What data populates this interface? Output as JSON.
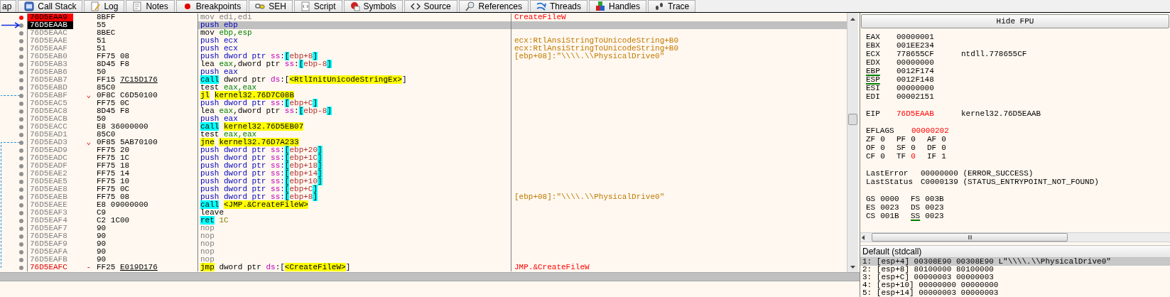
{
  "tabs": [
    "ap",
    "Call Stack",
    "Log",
    "Notes",
    "Breakpoints",
    "SEH",
    "Script",
    "Symbols",
    "Source",
    "References",
    "Threads",
    "Handles",
    "Trace"
  ],
  "disassembly": [
    {
      "address": "76D5EAA9",
      "kind": "breakpoint",
      "breakpoint": true,
      "selected": false,
      "bytes": [
        "8BFF"
      ],
      "reloc": false,
      "tokens": [
        {
          "text": "mov edi,edi",
          "kind": "dim"
        }
      ],
      "comment": {
        "text": "CreateFileW",
        "kind": "label"
      }
    },
    {
      "address": "76D5EAAB",
      "kind": "eip",
      "breakpoint": false,
      "selected": true,
      "bytes": [
        "55"
      ],
      "reloc": false,
      "tokens": [
        {
          "text": "push ebp",
          "kind": "push"
        }
      ]
    },
    {
      "address": "76D5EAAC",
      "kind": "normal",
      "breakpoint": false,
      "selected": false,
      "bytes": [
        "8BEC"
      ],
      "reloc": false,
      "tokens": [
        {
          "text": "mov ",
          "kind": "plain"
        },
        {
          "text": "ebp,esp",
          "kind": "reg"
        }
      ]
    },
    {
      "address": "76D5EAAE",
      "kind": "normal",
      "breakpoint": false,
      "selected": false,
      "bytes": [
        "51"
      ],
      "reloc": false,
      "tokens": [
        {
          "text": "push ecx",
          "kind": "push"
        }
      ],
      "comment": {
        "text": "ecx:RtlAnsiStringToUnicodeString+B0",
        "kind": "auto"
      }
    },
    {
      "address": "76D5EAAF",
      "kind": "normal",
      "breakpoint": false,
      "selected": false,
      "bytes": [
        "51"
      ],
      "reloc": false,
      "tokens": [
        {
          "text": "push ecx",
          "kind": "push"
        }
      ],
      "comment": {
        "text": "ecx:RtlAnsiStringToUnicodeString+B0",
        "kind": "auto"
      }
    },
    {
      "address": "76D5EAB0",
      "kind": "normal",
      "breakpoint": false,
      "selected": false,
      "bytes": [
        "FF75",
        "08"
      ],
      "reloc": false,
      "tokens": [
        {
          "text": "push dword ptr ",
          "kind": "push"
        },
        {
          "text": "ss",
          "kind": "seg"
        },
        {
          "text": ":",
          "kind": "push"
        },
        {
          "text": "[ebp+8]",
          "kind": "mem"
        }
      ],
      "comment": {
        "text": "[ebp+08]:\"\\\\\\\\.\\\\PhysicalDrive0\"",
        "kind": "auto"
      }
    },
    {
      "address": "76D5EAB3",
      "kind": "normal",
      "breakpoint": false,
      "selected": false,
      "bytes": [
        "8D45",
        "F8"
      ],
      "reloc": false,
      "tokens": [
        {
          "text": "lea ",
          "kind": "plain"
        },
        {
          "text": "eax",
          "kind": "reg"
        },
        {
          "text": ",dword ptr ",
          "kind": "plain"
        },
        {
          "text": "ss",
          "kind": "seg"
        },
        {
          "text": ":",
          "kind": "plain"
        },
        {
          "text": "[ebp-8]",
          "kind": "mem"
        }
      ]
    },
    {
      "address": "76D5EAB6",
      "kind": "normal",
      "breakpoint": false,
      "selected": false,
      "bytes": [
        "50"
      ],
      "reloc": false,
      "tokens": [
        {
          "text": "push eax",
          "kind": "push"
        }
      ]
    },
    {
      "address": "76D5EAB7",
      "kind": "normal",
      "breakpoint": false,
      "selected": false,
      "bytes": [
        "FF15",
        "7C15D176"
      ],
      "reloc": true,
      "tokens": [
        {
          "text": "call",
          "kind": "callop"
        },
        {
          "text": " dword ptr ",
          "kind": "plain"
        },
        {
          "text": "ds",
          "kind": "seg"
        },
        {
          "text": ":[",
          "kind": "plain"
        },
        {
          "text": "<RtlInitUnicodeStringEx>",
          "kind": "sym"
        },
        {
          "text": "]",
          "kind": "plain"
        }
      ]
    },
    {
      "address": "76D5EABD",
      "kind": "normal",
      "breakpoint": false,
      "selected": false,
      "bytes": [
        "85C0"
      ],
      "reloc": false,
      "tokens": [
        {
          "text": "test ",
          "kind": "plain"
        },
        {
          "text": "eax,eax",
          "kind": "reg"
        }
      ]
    },
    {
      "address": "76D5EABF",
      "kind": "normal",
      "breakpoint": false,
      "selected": false,
      "mark": "⌄",
      "bytes": [
        "0F8C",
        "C6D50100"
      ],
      "reloc": false,
      "tokens": [
        {
          "text": "jl ",
          "kind": "jmpop"
        },
        {
          "text": "kernel32.76D7C08B",
          "kind": "sym"
        }
      ]
    },
    {
      "address": "76D5EAC5",
      "kind": "normal",
      "breakpoint": false,
      "selected": false,
      "bytes": [
        "FF75",
        "0C"
      ],
      "reloc": false,
      "tokens": [
        {
          "text": "push dword ptr ",
          "kind": "push"
        },
        {
          "text": "ss",
          "kind": "seg"
        },
        {
          "text": ":",
          "kind": "push"
        },
        {
          "text": "[ebp+C]",
          "kind": "mem"
        }
      ]
    },
    {
      "address": "76D5EAC8",
      "kind": "normal",
      "breakpoint": false,
      "selected": false,
      "bytes": [
        "8D45",
        "F8"
      ],
      "reloc": false,
      "tokens": [
        {
          "text": "lea ",
          "kind": "plain"
        },
        {
          "text": "eax",
          "kind": "reg"
        },
        {
          "text": ",dword ptr ",
          "kind": "plain"
        },
        {
          "text": "ss",
          "kind": "seg"
        },
        {
          "text": ":",
          "kind": "plain"
        },
        {
          "text": "[ebp-8]",
          "kind": "mem"
        }
      ]
    },
    {
      "address": "76D5EACB",
      "kind": "normal",
      "breakpoint": false,
      "selected": false,
      "bytes": [
        "50"
      ],
      "reloc": false,
      "tokens": [
        {
          "text": "push eax",
          "kind": "push"
        }
      ]
    },
    {
      "address": "76D5EACC",
      "kind": "normal",
      "breakpoint": false,
      "selected": false,
      "bytes": [
        "E8",
        "36000000"
      ],
      "reloc": false,
      "tokens": [
        {
          "text": "call ",
          "kind": "callop"
        },
        {
          "text": "kernel32.76D5EB07",
          "kind": "sym"
        }
      ]
    },
    {
      "address": "76D5EAD1",
      "kind": "normal",
      "breakpoint": false,
      "selected": false,
      "bytes": [
        "85C0"
      ],
      "reloc": false,
      "tokens": [
        {
          "text": "test ",
          "kind": "plain"
        },
        {
          "text": "eax,eax",
          "kind": "reg"
        }
      ]
    },
    {
      "address": "76D5EAD3",
      "kind": "normal",
      "breakpoint": false,
      "selected": false,
      "mark": "⌄",
      "bytes": [
        "0F85",
        "5AB70100"
      ],
      "reloc": false,
      "tokens": [
        {
          "text": "jne ",
          "kind": "jmpop"
        },
        {
          "text": "kernel32.76D7A233",
          "kind": "sym"
        }
      ]
    },
    {
      "address": "76D5EAD9",
      "kind": "normal",
      "breakpoint": false,
      "selected": false,
      "bytes": [
        "FF75",
        "20"
      ],
      "reloc": false,
      "tokens": [
        {
          "text": "push dword ptr ",
          "kind": "push"
        },
        {
          "text": "ss",
          "kind": "seg"
        },
        {
          "text": ":",
          "kind": "push"
        },
        {
          "text": "[ebp+20]",
          "kind": "mem"
        }
      ]
    },
    {
      "address": "76D5EADC",
      "kind": "normal",
      "breakpoint": false,
      "selected": false,
      "bytes": [
        "FF75",
        "1C"
      ],
      "reloc": false,
      "tokens": [
        {
          "text": "push dword ptr ",
          "kind": "push"
        },
        {
          "text": "ss",
          "kind": "seg"
        },
        {
          "text": ":",
          "kind": "push"
        },
        {
          "text": "[ebp+1C]",
          "kind": "mem"
        }
      ]
    },
    {
      "address": "76D5EADF",
      "kind": "normal",
      "breakpoint": false,
      "selected": false,
      "bytes": [
        "FF75",
        "18"
      ],
      "reloc": false,
      "tokens": [
        {
          "text": "push dword ptr ",
          "kind": "push"
        },
        {
          "text": "ss",
          "kind": "seg"
        },
        {
          "text": ":",
          "kind": "push"
        },
        {
          "text": "[ebp+18]",
          "kind": "mem"
        }
      ]
    },
    {
      "address": "76D5EAE2",
      "kind": "normal",
      "breakpoint": false,
      "selected": false,
      "bytes": [
        "FF75",
        "14"
      ],
      "reloc": false,
      "tokens": [
        {
          "text": "push dword ptr ",
          "kind": "push"
        },
        {
          "text": "ss",
          "kind": "seg"
        },
        {
          "text": ":",
          "kind": "push"
        },
        {
          "text": "[ebp+14]",
          "kind": "mem"
        }
      ]
    },
    {
      "address": "76D5EAE5",
      "kind": "normal",
      "breakpoint": false,
      "selected": false,
      "bytes": [
        "FF75",
        "10"
      ],
      "reloc": false,
      "tokens": [
        {
          "text": "push dword ptr ",
          "kind": "push"
        },
        {
          "text": "ss",
          "kind": "seg"
        },
        {
          "text": ":",
          "kind": "push"
        },
        {
          "text": "[ebp+10]",
          "kind": "mem"
        }
      ]
    },
    {
      "address": "76D5EAE8",
      "kind": "normal",
      "breakpoint": false,
      "selected": false,
      "bytes": [
        "FF75",
        "0C"
      ],
      "reloc": false,
      "tokens": [
        {
          "text": "push dword ptr ",
          "kind": "push"
        },
        {
          "text": "ss",
          "kind": "seg"
        },
        {
          "text": ":",
          "kind": "push"
        },
        {
          "text": "[ebp+C]",
          "kind": "mem"
        }
      ]
    },
    {
      "address": "76D5EAEB",
      "kind": "normal",
      "breakpoint": false,
      "selected": false,
      "bytes": [
        "FF75",
        "08"
      ],
      "reloc": false,
      "tokens": [
        {
          "text": "push dword ptr ",
          "kind": "push"
        },
        {
          "text": "ss",
          "kind": "seg"
        },
        {
          "text": ":",
          "kind": "push"
        },
        {
          "text": "[ebp+8]",
          "kind": "mem"
        }
      ],
      "comment": {
        "text": "[ebp+08]:\"\\\\\\\\.\\\\PhysicalDrive0\"",
        "kind": "auto"
      }
    },
    {
      "address": "76D5EAEE",
      "kind": "normal",
      "breakpoint": false,
      "selected": false,
      "bytes": [
        "E8",
        "09000000"
      ],
      "reloc": false,
      "tokens": [
        {
          "text": "call ",
          "kind": "callop"
        },
        {
          "text": "<JMP.&CreateFileW>",
          "kind": "sym"
        }
      ]
    },
    {
      "address": "76D5EAF3",
      "kind": "normal",
      "breakpoint": false,
      "selected": false,
      "bytes": [
        "C9"
      ],
      "reloc": false,
      "tokens": [
        {
          "text": "leave",
          "kind": "plain"
        }
      ]
    },
    {
      "address": "76D5EAF4",
      "kind": "normal",
      "breakpoint": false,
      "selected": false,
      "bytes": [
        "C2",
        "1C00"
      ],
      "reloc": false,
      "tokens": [
        {
          "text": "ret ",
          "kind": "callop"
        },
        {
          "text": "1C",
          "kind": "imm"
        }
      ]
    },
    {
      "address": "76D5EAF7",
      "kind": "normal",
      "breakpoint": false,
      "selected": false,
      "bytes": [
        "90"
      ],
      "reloc": false,
      "tokens": [
        {
          "text": "nop",
          "kind": "dim"
        }
      ]
    },
    {
      "address": "76D5EAF8",
      "kind": "normal",
      "breakpoint": false,
      "selected": false,
      "bytes": [
        "90"
      ],
      "reloc": false,
      "tokens": [
        {
          "text": "nop",
          "kind": "dim"
        }
      ]
    },
    {
      "address": "76D5EAF9",
      "kind": "normal",
      "breakpoint": false,
      "selected": false,
      "bytes": [
        "90"
      ],
      "reloc": false,
      "tokens": [
        {
          "text": "nop",
          "kind": "dim"
        }
      ]
    },
    {
      "address": "76D5EAFA",
      "kind": "normal",
      "breakpoint": false,
      "selected": false,
      "bytes": [
        "90"
      ],
      "reloc": false,
      "tokens": [
        {
          "text": "nop",
          "kind": "dim"
        }
      ]
    },
    {
      "address": "76D5EAFB",
      "kind": "normal",
      "breakpoint": false,
      "selected": false,
      "bytes": [
        "90"
      ],
      "reloc": false,
      "tokens": [
        {
          "text": "nop",
          "kind": "dim"
        }
      ]
    },
    {
      "address": "76D5EAFC",
      "kind": "label",
      "breakpoint": false,
      "selected": false,
      "mark": "-",
      "bytes": [
        "FF25",
        "E019D176"
      ],
      "reloc": true,
      "tokens": [
        {
          "text": "jmp",
          "kind": "jmpop"
        },
        {
          "text": " dword ptr ",
          "kind": "plain"
        },
        {
          "text": "ds",
          "kind": "seg"
        },
        {
          "text": ":[",
          "kind": "plain"
        },
        {
          "text": "<CreateFileW>",
          "kind": "sym"
        },
        {
          "text": "]",
          "kind": "plain"
        }
      ],
      "comment": {
        "text": "JMP.&CreateFileW",
        "kind": "label"
      }
    }
  ],
  "fpu_button": "Hide FPU",
  "registers": [
    {
      "name": "EAX",
      "value": "00000001",
      "marked": false,
      "changed": false
    },
    {
      "name": "EBX",
      "value": "001EE234",
      "marked": false,
      "changed": false
    },
    {
      "name": "ECX",
      "value": "778655CF",
      "comment": "ntdll.778655CF",
      "marked": false,
      "changed": false
    },
    {
      "name": "EDX",
      "value": "00000000",
      "marked": false,
      "changed": false
    },
    {
      "name": "EBP",
      "value": "0012F174",
      "marked": true,
      "changed": false
    },
    {
      "name": "ESP",
      "value": "0012F148",
      "marked": true,
      "changed": false
    },
    {
      "name": "ESI",
      "value": "00000000",
      "marked": false,
      "changed": false
    },
    {
      "name": "EDI",
      "value": "00002151",
      "marked": false,
      "changed": false
    }
  ],
  "eip": {
    "name": "EIP",
    "value": "76D5EAAB",
    "comment": "kernel32.76D5EAAB",
    "marked": false,
    "changed": true
  },
  "eflags": {
    "name": "EFLAGS",
    "value": "00000202",
    "changed": true
  },
  "flags": [
    [
      {
        "name": "ZF",
        "value": "0",
        "changed": false
      },
      {
        "name": "PF",
        "value": "0",
        "changed": false
      },
      {
        "name": "AF",
        "value": "0",
        "changed": false
      }
    ],
    [
      {
        "name": "OF",
        "value": "0",
        "changed": false
      },
      {
        "name": "SF",
        "value": "0",
        "changed": false
      },
      {
        "name": "DF",
        "value": "0",
        "changed": false
      }
    ],
    [
      {
        "name": "CF",
        "value": "0",
        "changed": false
      },
      {
        "name": "TF",
        "value": "0",
        "changed": true
      },
      {
        "name": "IF",
        "value": "1",
        "changed": false
      }
    ]
  ],
  "last_error": {
    "label": "LastError",
    "value": "00000000 (ERROR_SUCCESS)"
  },
  "last_status": {
    "label": "LastStatus",
    "value": "C0000139 (STATUS_ENTRYPOINT_NOT_FOUND)"
  },
  "segments": [
    [
      {
        "name": "GS",
        "value": "0000",
        "marked": false
      },
      {
        "name": "FS",
        "value": "003B",
        "marked": false
      }
    ],
    [
      {
        "name": "ES",
        "value": "0023",
        "marked": false
      },
      {
        "name": "DS",
        "value": "0023",
        "marked": false
      }
    ],
    [
      {
        "name": "CS",
        "value": "001B",
        "marked": false
      },
      {
        "name": "SS",
        "value": "0023",
        "marked": true
      }
    ]
  ],
  "call_convention": "Default (stdcall)",
  "arguments": [
    {
      "text": "1: [esp+4] 00308E90 00308E90 L\"\\\\\\\\.\\\\PhysicalDrive0\"",
      "selected": true
    },
    {
      "text": "2: [esp+8] 80100000 80100000",
      "selected": false
    },
    {
      "text": "3: [esp+C] 00000003 00000003",
      "selected": false
    },
    {
      "text": "4: [esp+10] 00000000 00000000",
      "selected": false
    },
    {
      "text": "5: [esp+14] 00000003 00000003",
      "selected": false
    }
  ]
}
